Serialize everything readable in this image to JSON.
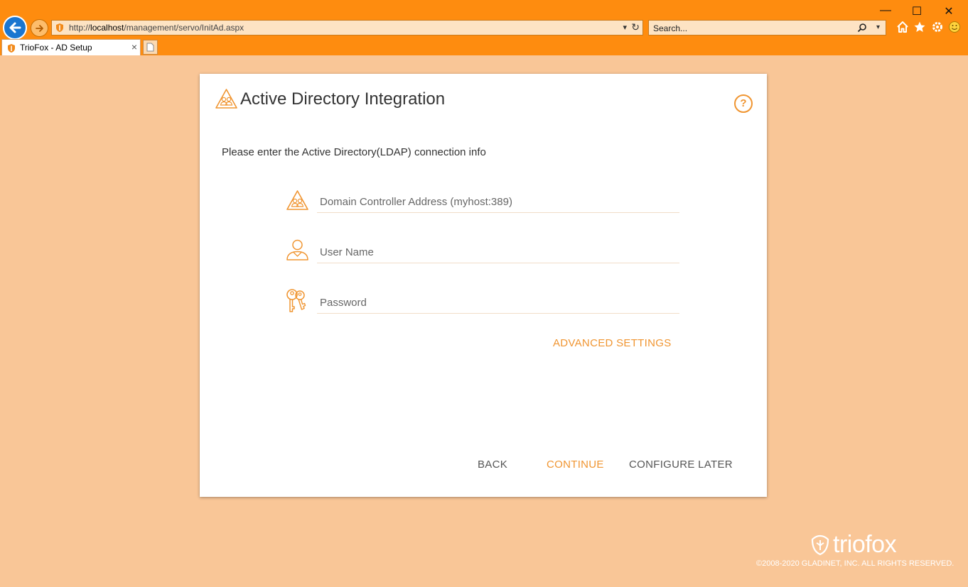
{
  "browser": {
    "url_prefix": "http://",
    "url_host": "localhost",
    "url_path": "/management/servo/InitAd.aspx",
    "search_placeholder": "Search...",
    "tab_title": "TrioFox - AD Setup",
    "tab_close": "×",
    "dropdown_glyph": "▾",
    "refresh_glyph": "↻",
    "minimize_glyph": "—",
    "maximize_glyph": "☐",
    "close_glyph": "✕"
  },
  "card": {
    "title": "Active Directory Integration",
    "help_glyph": "?",
    "instructions": "Please enter the Active Directory(LDAP) connection info",
    "fields": {
      "domain_placeholder": "Domain Controller Address (myhost:389)",
      "username_placeholder": "User Name",
      "password_placeholder": "Password"
    },
    "advanced_settings": "ADVANCED SETTINGS",
    "buttons": {
      "back": "BACK",
      "continue": "CONTINUE",
      "configure_later": "CONFIGURE LATER"
    }
  },
  "footer": {
    "logo_text": "triofox",
    "copyright": "©2008-2020 GLADINET, INC. ALL RIGHTS RESERVED."
  },
  "colors": {
    "chrome": "#fe8c0f",
    "page_bg": "#f9c697",
    "accent": "#f09531",
    "back_button": "#1b76d0"
  },
  "icons": {
    "back": "arrow-left-icon",
    "forward": "arrow-right-icon",
    "site": "shield-favicon-icon",
    "search": "search-icon",
    "home": "home-icon",
    "favorites": "star-icon",
    "tools": "gear-icon",
    "feedback": "smiley-icon",
    "active_directory": "ad-triangle-icon",
    "user": "user-icon",
    "password": "keys-icon",
    "help": "help-icon"
  }
}
